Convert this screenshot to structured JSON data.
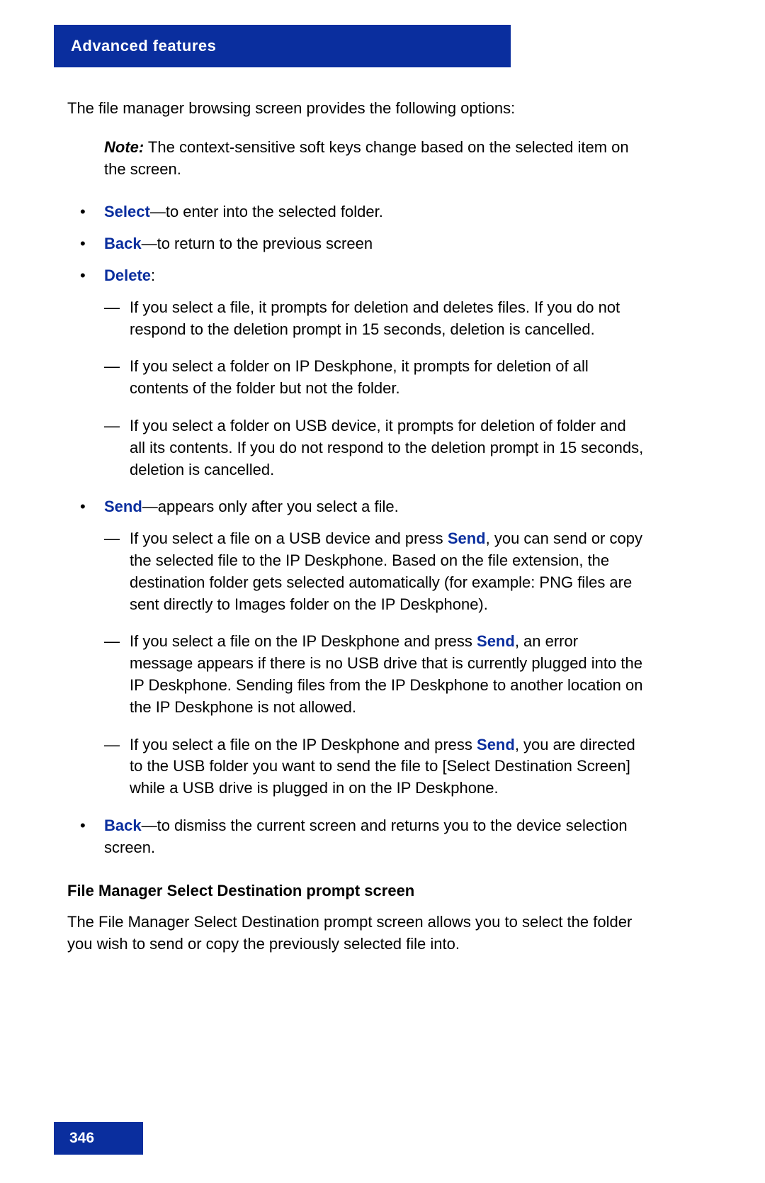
{
  "header": {
    "title": "Advanced features"
  },
  "intro": "The file manager browsing screen provides the following options:",
  "note": {
    "label": "Note:",
    "text": "  The context-sensitive soft keys change based on the selected item on the screen."
  },
  "bullets": {
    "select": {
      "kw": "Select",
      "text": "—to enter into the selected folder."
    },
    "back1": {
      "kw": "Back",
      "text": "—to return to the previous screen"
    },
    "delete": {
      "kw": "Delete",
      "text": ":",
      "subitems": {
        "d1": "If you select a file, it prompts for deletion and deletes files. If you do not respond to the deletion prompt in 15 seconds, deletion is cancelled.",
        "d2": "If you select a folder on IP Deskphone, it prompts for deletion of all contents of the folder but not the folder.",
        "d3": "If you select a folder on USB device, it prompts for deletion of folder and all its contents. If you do not respond to the deletion prompt in 15 seconds, deletion is cancelled."
      }
    },
    "send": {
      "kw": "Send",
      "text": "—appears only after you select a file.",
      "subitems": {
        "s1a": "If you select a file on a USB device and press ",
        "s1kw": "Send",
        "s1b": ", you can send or copy the selected file to the IP Deskphone. Based on the file extension, the destination folder gets selected automatically (for example: PNG files are sent directly to Images folder on the IP Deskphone).",
        "s2a": "If you select a file on the IP Deskphone and press ",
        "s2kw": "Send",
        "s2b": ", an error message appears if there is no USB drive that is currently plugged into the IP Deskphone. Sending files from the IP Deskphone to another location on the IP Deskphone is not allowed.",
        "s3a": "If you select a file on the IP Deskphone and press ",
        "s3kw": "Send",
        "s3b": ", you are directed to the USB folder you want to send the file to [Select Destination Screen] while a USB drive is plugged in on the IP Deskphone."
      }
    },
    "back2": {
      "kw": "Back",
      "text": "—to dismiss the current screen and returns you to the device selection screen."
    }
  },
  "section": {
    "heading": "File Manager Select Destination prompt screen",
    "body": "The File Manager Select Destination prompt screen allows you to select the folder you wish to send or copy the previously selected file into."
  },
  "pageNumber": "346"
}
